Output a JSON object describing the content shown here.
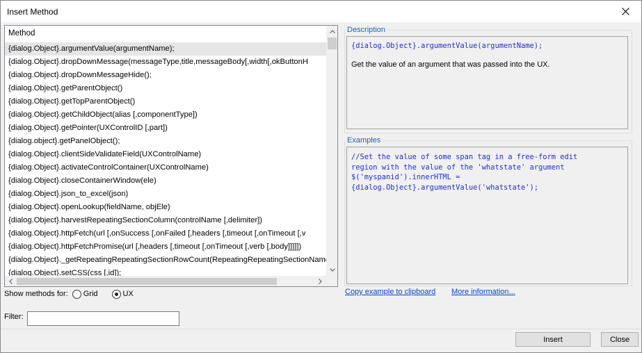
{
  "window": {
    "title": "Insert Method"
  },
  "methods": {
    "header": "Method",
    "selected_index": 0,
    "items": [
      "{dialog.Object}.argumentValue(argumentName);",
      "{dialog.Object}.dropDownMessage(messageType,title,messageBody[,width[,okButtonH",
      "{dialog.Object}.dropDownMessageHide();",
      "{dialog.Object}.getParentObject()",
      "{dialog.Object}.getTopParentObject()",
      "{dialog.Object}.getChildObject(alias [,componentType])",
      "{dialog.Object}.getPointer(UXControlID [,part])",
      "{dialog.object}.getPanelObject();",
      "{dialog.Object}.clientSideValidateField(UXControlName)",
      "{dialog.Object}.activateControlContainer(UXControlName)",
      "{dialog.Object}.closeContainerWindow(ele)",
      "{dialog.Object}.json_to_excel(json)",
      "{dialog.Object}.openLookup(fieldName, objEle)",
      "{dialog.Object}.harvestRepeatingSectionColumn(controlName [,delimiter])",
      "{dialog.Object}.httpFetch(url [,onSuccess [,onFailed [,headers [,timeout [,onTimeout [,v",
      "{dialog.Object}.httpFetchPromise(url [,headers [,timeout [,onTimeout [,verb [,body]]]]])",
      "{dialog.Object}._getRepeatingRepeatingSectionRowCount(RepeatingRepeatingSectionName);",
      "{dialog.Object}.setCSS(css [,id]);"
    ]
  },
  "show_methods": {
    "label": "Show methods for:",
    "options": [
      {
        "label": "Grid",
        "checked": false
      },
      {
        "label": "UX",
        "checked": true
      }
    ]
  },
  "filter": {
    "label": "Filter:",
    "value": ""
  },
  "description": {
    "label": "Description",
    "code": "{dialog.Object}.argumentValue(argumentName);",
    "text": "Get the value of an argument that was passed into the UX."
  },
  "examples": {
    "label": "Examples",
    "code": "//Set the value of some span tag in a free-form edit\nregion with the value of the 'whatstate' argument\n$('myspanid').innerHTML =\n{dialog.Object}.argumentValue('whatstate');"
  },
  "links": {
    "copy": "Copy example to clipboard",
    "more": "More information..."
  },
  "buttons": {
    "insert": "Insert",
    "close": "Close"
  },
  "colors": {
    "accent": "#1e5fb4",
    "code": "#1e2fc8",
    "link": "#0645c8"
  }
}
